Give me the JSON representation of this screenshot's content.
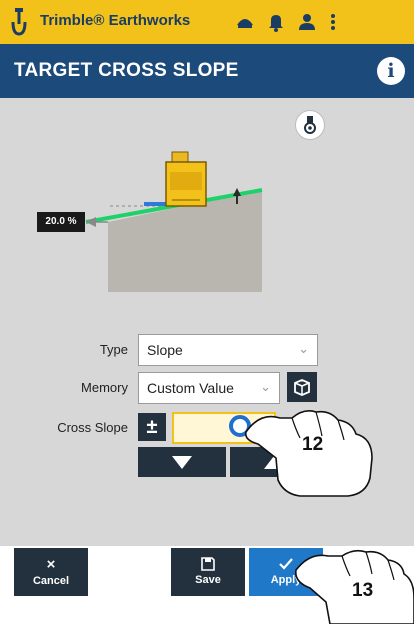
{
  "status_bar": {
    "app_name": "Trimble® Earthworks"
  },
  "header": {
    "title": "TARGET CROSS SLOPE",
    "info_glyph": "i"
  },
  "diagram": {
    "slope_badge": "20.0 %"
  },
  "form": {
    "type": {
      "label": "Type",
      "value": "Slope"
    },
    "memory": {
      "label": "Memory",
      "value": "Custom Value"
    },
    "cross_slope": {
      "label": "Cross Slope",
      "plusminus": "±"
    }
  },
  "footer": {
    "cancel": {
      "label": "Cancel",
      "icon": "×"
    },
    "save": {
      "label": "Save"
    },
    "apply": {
      "label": "Apply"
    }
  },
  "callouts": {
    "first": "12",
    "second": "13"
  },
  "colors": {
    "status_yellow": "#f2c21b",
    "header_blue": "#1c4a7a",
    "button_dark": "#23313f",
    "apply_blue": "#1f78c8",
    "slope_green": "#1fd16a"
  }
}
